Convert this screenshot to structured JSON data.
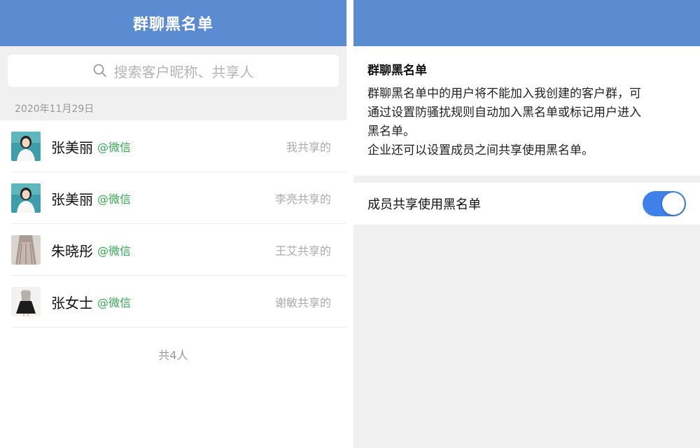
{
  "left": {
    "title": "群聊黑名单",
    "search": {
      "placeholder": "搜索客户昵称、共享人",
      "icon": "search-icon"
    },
    "date": "2020年11月29日",
    "contacts": [
      {
        "name": "张美丽",
        "tag": "@微信",
        "sharer": "我共享的",
        "avatar": "avatar-photo-woman"
      },
      {
        "name": "张美丽",
        "tag": "@微信",
        "sharer": "李亮共享的",
        "avatar": "avatar-photo-woman"
      },
      {
        "name": "朱晓彤",
        "tag": "@微信",
        "sharer": "王艾共享的",
        "avatar": "avatar-photo-dress"
      },
      {
        "name": "张女士",
        "tag": "@微信",
        "sharer": "谢敏共享的",
        "avatar": "avatar-photo-skirt"
      }
    ],
    "total": "共4人"
  },
  "right": {
    "info_title": "群聊黑名单",
    "info_lines": [
      "群聊黑名单中的用户将不能加入我创建的客户群，可",
      "通过设置防骚扰规则自动加入黑名单或标记用户进入",
      "黑名单。",
      "企业还可以设置成员之间共享使用黑名单。"
    ],
    "setting_label": "成员共享使用黑名单",
    "setting_enabled": true
  },
  "colors": {
    "header": "#5b8bd1",
    "tag_green": "#33a852",
    "toggle_on": "#3f80ea"
  }
}
